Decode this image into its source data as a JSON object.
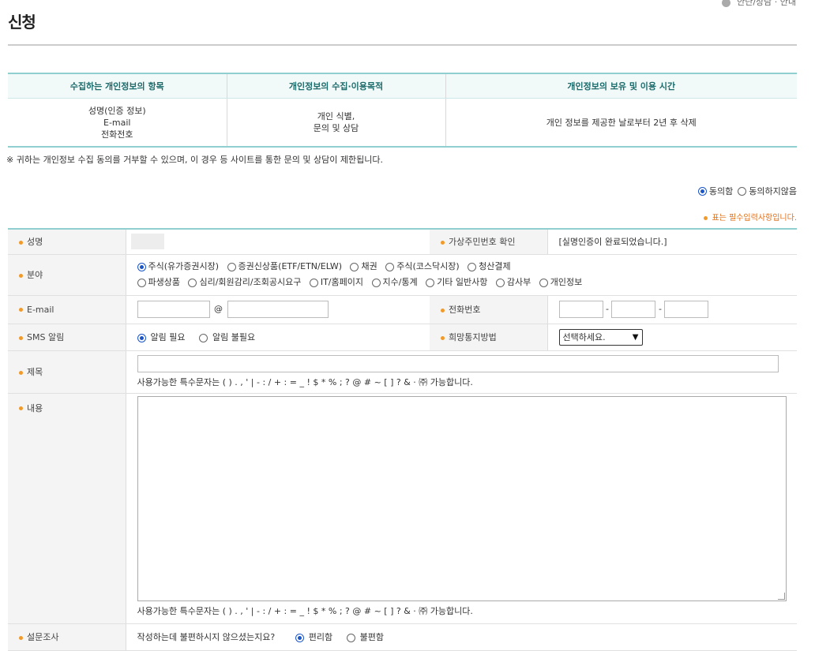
{
  "page": {
    "title": "신청",
    "crumb": "안단/상담 · 안내"
  },
  "privacy": {
    "headers": [
      "수집하는 개인정보의 항목",
      "개인정보의 수집·이용목적",
      "개인정보의 보유 및 이용 시간"
    ],
    "items": [
      "성명(인증 정보)",
      "E-mail",
      "전화전호"
    ],
    "purpose": [
      "개인 식별,",
      "문의 및 상담"
    ],
    "retention": "개인 정보를 제공한 날로부터 2년 후 삭제",
    "notice": "※ 귀하는 개인정보 수집 동의를 거부할 수 있으며, 이 경우 등 사이트를 통한 문의 및 상담이 제한됩니다.",
    "agree_label": "동의함",
    "disagree_label": "동의하지않음",
    "agree_selected": true
  },
  "required_note": "표는 필수입력사항입니다.",
  "form": {
    "name": {
      "label": "성명"
    },
    "verify": {
      "label": "가상주민번호 확인",
      "status": "[실명인증이 완료되었습니다.]"
    },
    "field": {
      "label": "분야",
      "row1": [
        "주식(유가증권시장)",
        "증권신상품(ETF/ETN/ELW)",
        "채권",
        "주식(코스닥시장)",
        "청산결제"
      ],
      "row2": [
        "파생상품",
        "심리/회원감리/조회공시요구",
        "IT/홈페이지",
        "지수/통계",
        "기타 일반사항",
        "감사부",
        "개인정보"
      ],
      "selected": "주식(유가증권시장)"
    },
    "email": {
      "label": "E-mail",
      "at": "@",
      "local": "",
      "domain": ""
    },
    "phone": {
      "label": "전화번호",
      "sep": "-",
      "p1": "",
      "p2": "",
      "p3": ""
    },
    "sms": {
      "label": "SMS 알림",
      "options": [
        "알림 필요",
        "알림 불필요"
      ],
      "selected": "알림 필요"
    },
    "notify": {
      "label": "희망통지방법",
      "value": "선택하세요."
    },
    "subject": {
      "label": "제목",
      "value": "",
      "hint": "사용가능한 특수문자는 ( ) . , ' | - : / + : = _ ! $ * % ; ? @ # ~ [ ] ? & · ㈜ 가능합니다."
    },
    "content": {
      "label": "내용",
      "value": "",
      "hint": "사용가능한 특수문자는 ( ) . , ' | - : / + : = _ ! $ * % ; ? @ # ~ [ ] ? & · ㈜ 가능합니다."
    },
    "survey": {
      "label": "설문조사",
      "question": "작성하는데 불편하시지 않으셨는지요?",
      "options": [
        "편리함",
        "불편함"
      ],
      "selected": "편리함"
    }
  },
  "colors": {
    "accent": "#8fcfcf",
    "radio": "#1a56c8",
    "required": "#f19a2a"
  }
}
